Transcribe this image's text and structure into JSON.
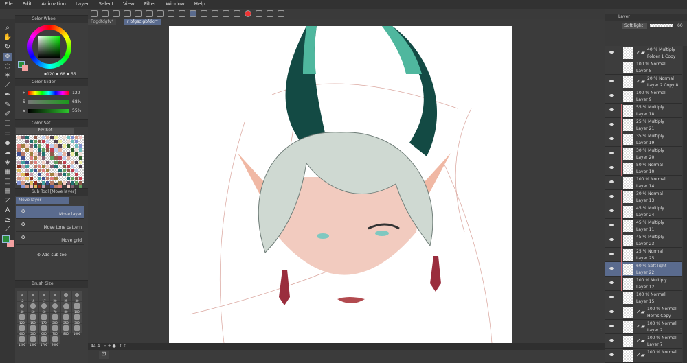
{
  "menu": [
    "File",
    "Edit",
    "Animation",
    "Layer",
    "Select",
    "View",
    "Filter",
    "Window",
    "Help"
  ],
  "tabs": [
    "Fdgdfdgfv*",
    "r bfgsc gbfdcr*"
  ],
  "panels": {
    "color_wheel": "Color Wheel",
    "color_slider": "Color Slider",
    "color_set": "Color Set",
    "sub_tool": "Sub Tool [Move layer]",
    "brush_size": "Brush Size",
    "layer": "Layer"
  },
  "color_wheel": {
    "h": "120",
    "s": "68",
    "v": "55",
    "main_color": "#2a8c3a",
    "sub_color": "#f4a0a0"
  },
  "color_slider": {
    "h_label": "H",
    "s_label": "S",
    "v_label": "V",
    "h": "120",
    "s": "68%",
    "v": "55%"
  },
  "color_set": {
    "set_name": "My Set"
  },
  "sub_tool": {
    "header": "Move layer",
    "items": [
      "Move layer",
      "Move tone pattern",
      "Move grid"
    ],
    "add": "Add sub tool"
  },
  "brush_sizes": [
    "12",
    "15",
    "17",
    "20",
    "25",
    "30",
    "40",
    "50",
    "60",
    "70",
    "80",
    "100",
    "120",
    "150",
    "170",
    "200",
    "250",
    "300",
    "400",
    "500",
    "600",
    "700",
    "800",
    "1000",
    "1200",
    "1500",
    "1700",
    "2000"
  ],
  "layer_panel": {
    "blend_mode": "Soft light",
    "opacity": "60",
    "layers": [
      {
        "a": "40 % Multiply",
        "b": "Folder 1 Copy",
        "eye": true,
        "folder": true
      },
      {
        "a": "100 % Normal",
        "b": "Layer 5",
        "eye": false
      },
      {
        "a": "20 % Normal",
        "b": "Layer 2 Copy 8",
        "eye": true,
        "folder": true
      },
      {
        "a": "100 % Normal",
        "b": "Layer 9",
        "eye": true
      },
      {
        "a": "55 % Multiply",
        "b": "Layer 18",
        "eye": true,
        "clip": true
      },
      {
        "a": "25 % Multiply",
        "b": "Layer 21",
        "eye": true,
        "clip": true
      },
      {
        "a": "35 % Multiply",
        "b": "Layer 19",
        "eye": true,
        "clip": true
      },
      {
        "a": "30 % Multiply",
        "b": "Layer 20",
        "eye": true,
        "clip": true
      },
      {
        "a": "50 % Normal",
        "b": "Layer 10",
        "eye": true,
        "clip": true
      },
      {
        "a": "100 % Normal",
        "b": "Layer 14",
        "eye": true
      },
      {
        "a": "30 % Normal",
        "b": "Layer 13",
        "eye": true,
        "clip": true
      },
      {
        "a": "45 % Multiply",
        "b": "Layer 24",
        "eye": true,
        "clip": true
      },
      {
        "a": "45 % Multiply",
        "b": "Layer 11",
        "eye": true,
        "clip": true
      },
      {
        "a": "45 % Multiply",
        "b": "Layer 23",
        "eye": true,
        "clip": true
      },
      {
        "a": "25 % Normal",
        "b": "Layer 25",
        "eye": true,
        "clip": true
      },
      {
        "a": "60 % Soft light",
        "b": "Layer 22",
        "eye": true,
        "clip": true,
        "sel": true
      },
      {
        "a": "100 % Multiply",
        "b": "Layer 12",
        "eye": true,
        "clip": true
      },
      {
        "a": "100 % Normal",
        "b": "Layer 15",
        "eye": true
      },
      {
        "a": "100 % Normal",
        "b": "Horns Copy",
        "eye": true,
        "folder": true
      },
      {
        "a": "100 % Normal",
        "b": "Layer 2",
        "eye": true,
        "folder": true
      },
      {
        "a": "100 % Normal",
        "b": "Layer 7",
        "eye": true,
        "folder": true
      },
      {
        "a": "100 % Normal",
        "b": "",
        "eye": true,
        "folder": true
      }
    ]
  },
  "status": {
    "zoom": "44.4",
    "angle": "0.0"
  }
}
